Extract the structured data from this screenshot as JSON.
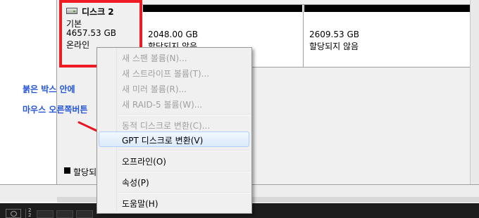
{
  "disk": {
    "name": "디스크 2",
    "type": "기본",
    "size": "4657.53 GB",
    "status": "온라인"
  },
  "partitions": [
    {
      "size": "2048.00 GB",
      "status": "할당되지 않음"
    },
    {
      "size": "2609.53 GB",
      "status": "할당되지 않음"
    }
  ],
  "legend": {
    "label": "할당되지 않음"
  },
  "annotation": {
    "line1": "붉은 박스 안에",
    "line2": "마우스 오른쪽버튼"
  },
  "context_menu": {
    "items": [
      {
        "label": "새 스팬 볼륨(N)...",
        "enabled": false
      },
      {
        "label": "새 스트라이프 볼륨(T)...",
        "enabled": false
      },
      {
        "label": "새 미러 볼륨(R)...",
        "enabled": false
      },
      {
        "label": "새 RAID-5 볼륨(W)...",
        "enabled": false
      },
      {
        "label": "동적 디스크로 변환(C)...",
        "enabled": false
      },
      {
        "label": "GPT 디스크로 변환(V)",
        "enabled": true,
        "highlighted": true
      },
      {
        "label": "오프라인(O)",
        "enabled": true
      },
      {
        "label": "속성(P)",
        "enabled": true
      },
      {
        "label": "도움말(H)",
        "enabled": true
      }
    ]
  },
  "taskbar": {
    "page_indicator": "2\n2"
  },
  "colors": {
    "highlight_box": "#ef1b24",
    "annotation_text": "#2455d6",
    "arrow": "#e8151f",
    "unallocated_bar": "#000000"
  }
}
